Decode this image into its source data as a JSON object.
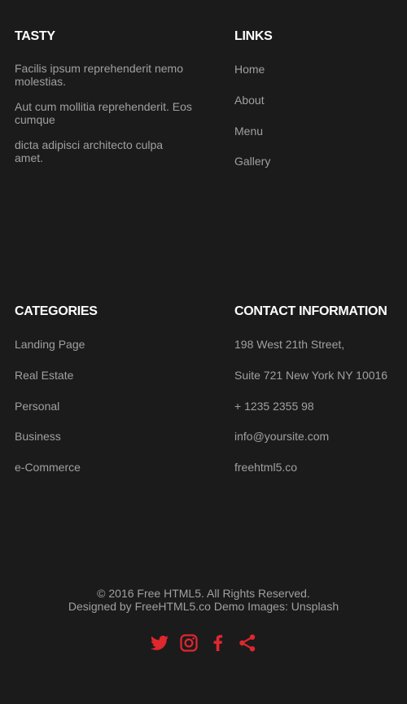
{
  "tasty": {
    "heading": "TASTY",
    "paragraphs": [
      "Facilis ipsum reprehenderit nemo molestias.",
      "Aut cum mollitia reprehenderit. Eos cumque",
      "dicta adipisci architecto culpa amet."
    ]
  },
  "links": {
    "heading": "LINKS",
    "items": [
      "Home",
      "About",
      "Menu",
      "Gallery"
    ]
  },
  "categories": {
    "heading": "CATEGORIES",
    "items": [
      "Landing Page",
      "Real Estate",
      "Personal",
      "Business",
      "e-Commerce"
    ]
  },
  "contact": {
    "heading": "CONTACT INFORMATION",
    "items": [
      "198 West 21th Street,",
      "Suite 721 New York NY 10016",
      "+ 1235 2355 98",
      "info@yoursite.com",
      "freehtml5.co"
    ]
  },
  "copyright": {
    "line1": "© 2016 Free HTML5. All Rights Reserved.",
    "designed_by_prefix": "Designed by",
    "designed_by_link": "FreeHTML5.co",
    "images_prefix": "Demo Images:",
    "images_link": "Unsplash"
  },
  "social": {
    "accent_color": "#e0272e",
    "icons": [
      "twitter-icon",
      "instagram-icon",
      "facebook-icon",
      "share-icon"
    ]
  }
}
